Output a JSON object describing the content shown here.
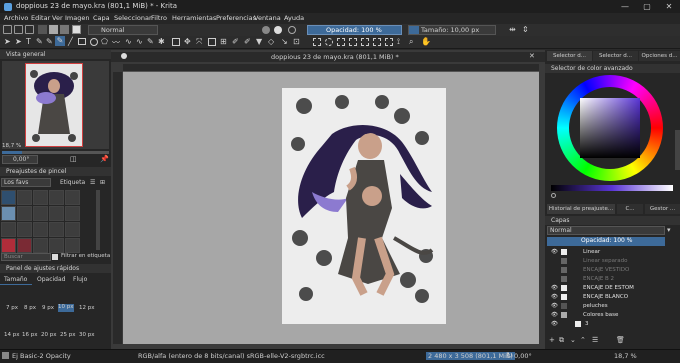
{
  "window": {
    "title": "doppious 23 de mayo.kra (801,1 MiB) * - Krita",
    "minimize": "—",
    "maximize": "▢",
    "close": "✕"
  },
  "menu": [
    "Archivo",
    "Editar",
    "Ver",
    "Imagen",
    "Capa",
    "Seleccionar",
    "Filtro",
    "Herramientas",
    "Preferencias",
    "Ventana",
    "Ayuda"
  ],
  "toolbar": {
    "blend_mode": "Normal",
    "opacity_label": "Opacidad: 100 %",
    "size_label": "Tamaño: 10,00 px"
  },
  "document": {
    "tab_title": "doppious 23 de mayo.kra (801,1 MiB) *"
  },
  "overview": {
    "title": "Vista general",
    "zoom": "18,7 %",
    "rotation": "0,00°"
  },
  "brush_presets": {
    "title": "Preajustes de pincel",
    "filter": "Los favs",
    "tag_label": "Etiqueta",
    "search_placeholder": "Buscar",
    "filter_by_tag": "Filtrar en etiqueta"
  },
  "quick_settings": {
    "title": "Panel de ajustes rápidos",
    "tabs": [
      "Tamaño",
      "Opacidad",
      "Flujo"
    ],
    "sizes_row1": [
      "7 px",
      "8 px",
      "9 px",
      "10 px",
      "12 px"
    ],
    "sizes_row2": [
      "14 px",
      "16 px",
      "20 px",
      "25 px",
      "30 px"
    ],
    "selected_size": "10 px"
  },
  "right_tabs": [
    "Selector d...",
    "Selector d...",
    "Opciones d..."
  ],
  "color_selector": {
    "title": "Selector de color avanzado"
  },
  "history_tabs": [
    "Historial de preajuste...",
    "C...",
    "Gestor ..."
  ],
  "layers": {
    "title": "Capas",
    "blend_mode": "Normal",
    "opacity_label": "Opacidad: 100 %",
    "items": [
      {
        "name": "Linear",
        "visible": true,
        "dim": false
      },
      {
        "name": "Linear separado",
        "visible": false,
        "dim": true
      },
      {
        "name": "ENCAJE VESTIDO",
        "visible": false,
        "dim": true
      },
      {
        "name": "ENCAJE B 2",
        "visible": false,
        "dim": true
      },
      {
        "name": "ENCAJE DE ESTOM",
        "visible": true,
        "dim": false
      },
      {
        "name": "ENCAJE BLANCO",
        "visible": true,
        "dim": false
      },
      {
        "name": "peluches",
        "visible": true,
        "dim": false
      },
      {
        "name": "Colores base",
        "visible": true,
        "dim": false
      },
      {
        "name": "3",
        "visible": true,
        "dim": false
      }
    ]
  },
  "status": {
    "brush": "Ej Basic-2 Opacity",
    "color_space": "RGB/alfa (entero de 8 bits/canal)  sRGB-elle-V2-srgbtrc.icc",
    "dimensions": "2 480 x 3 508 (801,1 MiB)",
    "rotation": "0,00°",
    "zoom": "18,7 %"
  },
  "colors": {
    "accent": "#3d6a99",
    "hair": "#2a1f4a",
    "dress": "#4a4744",
    "skin": "#c9a08a"
  }
}
